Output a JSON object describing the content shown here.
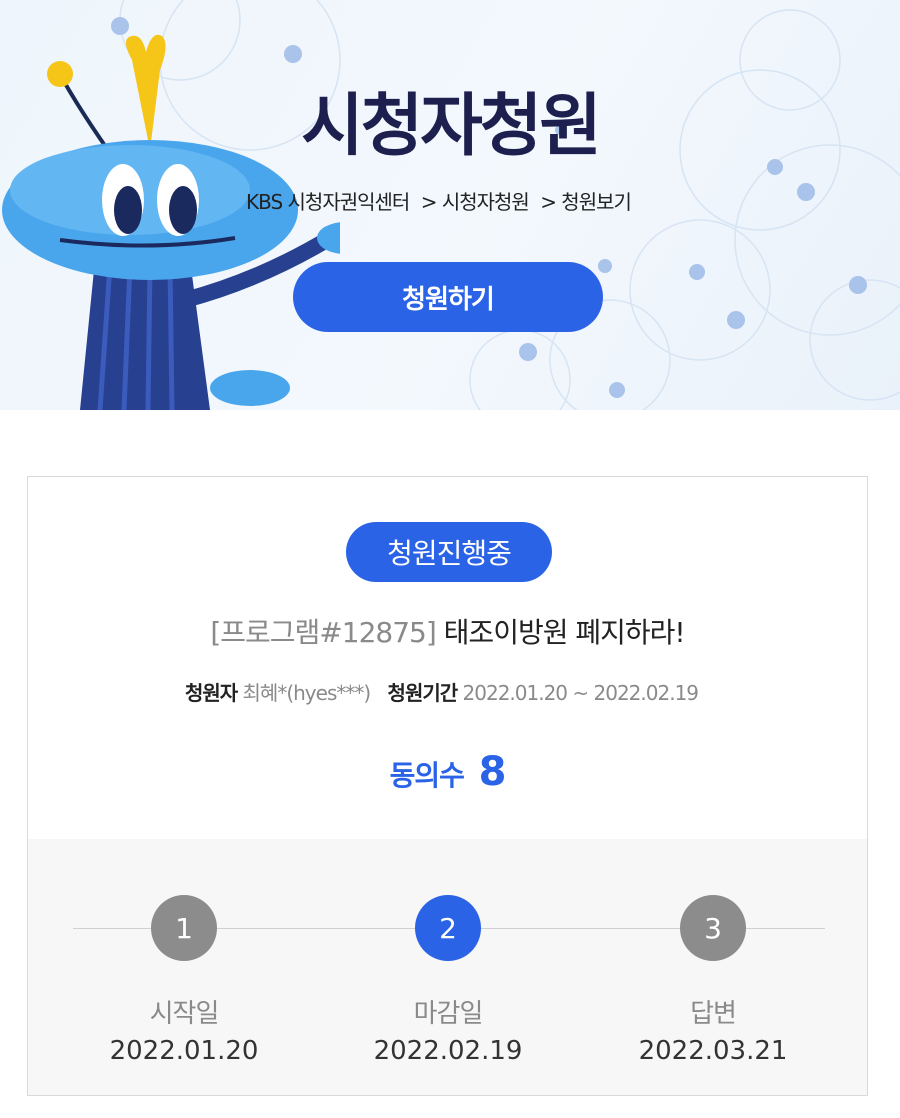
{
  "hero": {
    "title": "시청자청원",
    "breadcrumb": [
      "KBS 시청자권익센터",
      "> 시청자청원",
      "> 청원보기"
    ],
    "petition_button": "청원하기"
  },
  "petition": {
    "status": "청원진행중",
    "program": "[프로그램#12875]",
    "title": "태조이방원 폐지하라!",
    "petitioner_label": "청원자",
    "petitioner": "최혜*(hyes***)",
    "period_label": "청원기간",
    "period": "2022.01.20 ~ 2022.02.19",
    "agree_label": "동의수",
    "agree_count": "8"
  },
  "timeline": {
    "steps": [
      {
        "number": "1",
        "label": "시작일",
        "date": "2022.01.20"
      },
      {
        "number": "2",
        "label": "마감일",
        "date": "2022.02.19"
      },
      {
        "number": "3",
        "label": "답변",
        "date": "2022.03.21"
      }
    ],
    "active_step": 2
  },
  "colors": {
    "accent": "#2a63e6",
    "title": "#1d1f4e",
    "inactive_step": "#8c8c8c"
  },
  "icons": {
    "mascot": "kbs-mascot-illustration"
  }
}
